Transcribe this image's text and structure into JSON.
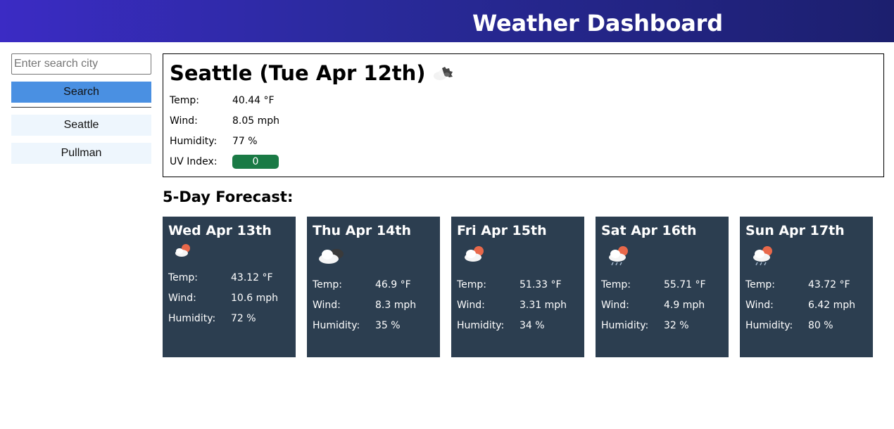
{
  "header": {
    "title": "Weather Dashboard"
  },
  "sidebar": {
    "search_placeholder": "Enter search city",
    "search_label": "Search",
    "history": [
      "Seattle",
      "Pullman"
    ]
  },
  "current": {
    "title": "Seattle (Tue Apr 12th)",
    "icon": "cloud-night-icon",
    "temp_label": "Temp:",
    "temp": "40.44 °F",
    "wind_label": "Wind:",
    "wind": "8.05 mph",
    "humidity_label": "Humidity:",
    "humidity": "77 %",
    "uv_label": "UV Index:",
    "uv": "0",
    "uv_color": "#1a7a45"
  },
  "forecast": {
    "heading": "5-Day Forecast:",
    "days": [
      {
        "date": "Wed Apr 13th",
        "icon": "cloud-sun-icon",
        "temp_label": "Temp:",
        "temp": "43.12 °F",
        "wind_label": "Wind:",
        "wind": "10.6 mph",
        "humidity_label": "Humidity:",
        "humidity": "72 %"
      },
      {
        "date": "Thu Apr 14th",
        "icon": "cloudy-icon",
        "temp_label": "Temp:",
        "temp": "46.9 °F",
        "wind_label": "Wind:",
        "wind": "8.3 mph",
        "humidity_label": "Humidity:",
        "humidity": "35 %"
      },
      {
        "date": "Fri Apr 15th",
        "icon": "cloud-sun-icon",
        "temp_label": "Temp:",
        "temp": "51.33 °F",
        "wind_label": "Wind:",
        "wind": "3.31 mph",
        "humidity_label": "Humidity:",
        "humidity": "34 %"
      },
      {
        "date": "Sat Apr 16th",
        "icon": "cloud-sun-rain-icon",
        "temp_label": "Temp:",
        "temp": "55.71 °F",
        "wind_label": "Wind:",
        "wind": "4.9 mph",
        "humidity_label": "Humidity:",
        "humidity": "32 %"
      },
      {
        "date": "Sun Apr 17th",
        "icon": "cloud-sun-rain-icon",
        "temp_label": "Temp:",
        "temp": "43.72 °F",
        "wind_label": "Wind:",
        "wind": "6.42 mph",
        "humidity_label": "Humidity:",
        "humidity": "80 %"
      }
    ]
  },
  "colors": {
    "header_gradient_start": "#3b2bc4",
    "header_gradient_end": "#1c1f6e",
    "search_button": "#4a90e2",
    "history_button": "#eef6fd",
    "card_background": "#2c3e50"
  }
}
